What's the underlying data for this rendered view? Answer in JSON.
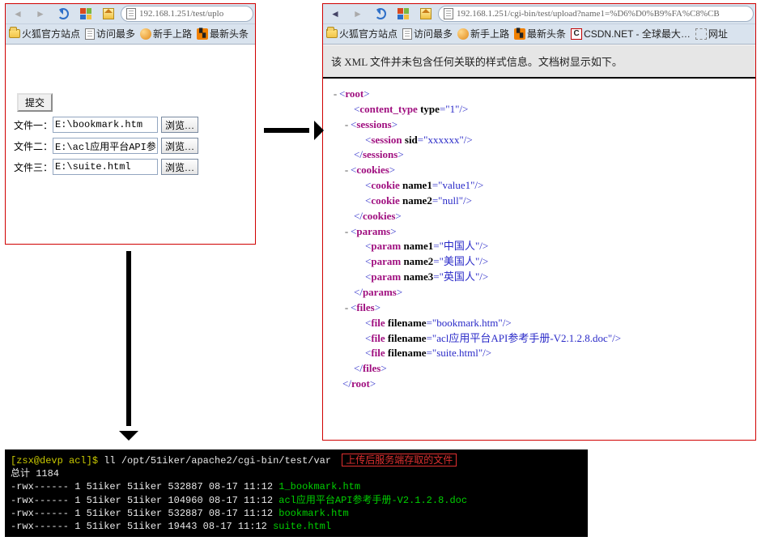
{
  "left": {
    "url": "192.168.1.251/test/uplo",
    "bm": {
      "a": "火狐官方站点",
      "b": "访问最多",
      "c": "新手上路",
      "d": "最新头条"
    },
    "submit": "提交",
    "browse": "浏览…",
    "l1": "文件一：",
    "l2": "文件二：",
    "l3": "文件三：",
    "v1": "E:\\bookmark.htm",
    "v2": "E:\\acl应用平台API参考引",
    "v3": "E:\\suite.html"
  },
  "right": {
    "url": "192.168.1.251/cgi-bin/test/upload?name1=%D6%D0%B9%FA%C8%CB",
    "bm": {
      "a": "火狐官方站点",
      "b": "访问最多",
      "c": "新手上路",
      "d": "最新头条",
      "e": "CSDN.NET - 全球最大…",
      "f": "网址"
    },
    "msg": "该 XML 文件并未包含任何关联的样式信息。文档树显示如下。",
    "xml": {
      "root": "root",
      "content_type": {
        "tag": "content_type",
        "attr": "type",
        "val": "1"
      },
      "sessions": "sessions",
      "session": {
        "tag": "session",
        "attr": "sid",
        "val": "xxxxxx"
      },
      "cookies": "cookies",
      "cookie1": {
        "tag": "cookie",
        "attr": "name1",
        "val": "value1"
      },
      "cookie2": {
        "tag": "cookie",
        "attr": "name2",
        "val": "null"
      },
      "params": "params",
      "param1": {
        "tag": "param",
        "attr": "name1",
        "val": "中国人"
      },
      "param2": {
        "tag": "param",
        "attr": "name2",
        "val": "美国人"
      },
      "param3": {
        "tag": "param",
        "attr": "name3",
        "val": "英国人"
      },
      "files": "files",
      "file1": {
        "tag": "file",
        "attr": "filename",
        "val": "bookmark.htm"
      },
      "file2": {
        "tag": "file",
        "attr": "filename",
        "val": "acl应用平台API参考手册-V2.1.2.8.doc"
      },
      "file3": {
        "tag": "file",
        "attr": "filename",
        "val": "suite.html"
      }
    }
  },
  "term": {
    "prompt_user": "zsx@devp",
    "prompt_dir": "acl",
    "cmd": "ll /opt/51iker/apache2/cgi-bin/test/var",
    "annot": "上传后服务端存取的文件",
    "total": "总计 1184",
    "rows": [
      {
        "perm": "-rwx------",
        "n": "1",
        "u": "51iker",
        "g": "51iker",
        "sz": "532887",
        "dt": "08-17 11:12",
        "f": "1_bookmark.htm"
      },
      {
        "perm": "-rwx------",
        "n": "1",
        "u": "51iker",
        "g": "51iker",
        "sz": "104960",
        "dt": "08-17 11:12",
        "f": "acl应用平台API参考手册-V2.1.2.8.doc"
      },
      {
        "perm": "-rwx------",
        "n": "1",
        "u": "51iker",
        "g": "51iker",
        "sz": "532887",
        "dt": "08-17 11:12",
        "f": "bookmark.htm"
      },
      {
        "perm": "-rwx------",
        "n": "1",
        "u": "51iker",
        "g": "51iker",
        "sz": " 19443",
        "dt": "08-17 11:12",
        "f": "suite.html"
      }
    ]
  }
}
